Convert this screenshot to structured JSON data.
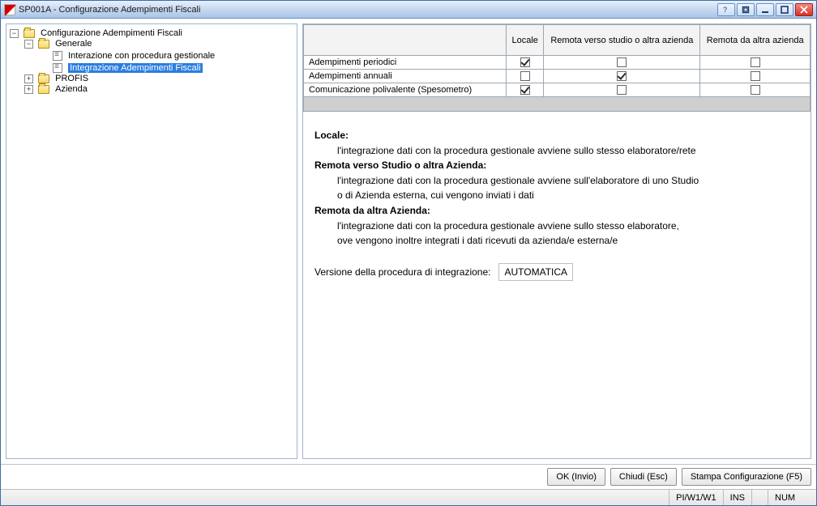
{
  "titlebar": {
    "title": "SP001A - Configurazione Adempimenti Fiscali"
  },
  "tree": {
    "root": "Configurazione Adempimenti Fiscali",
    "generale": "Generale",
    "interazione": "Interazione con procedura gestionale",
    "integrazione": "Integrazione Adempimenti Fiscali",
    "profis": "PROFIS",
    "azienda": "Azienda"
  },
  "grid": {
    "columns": [
      "Locale",
      "Remota verso studio o altra azienda",
      "Remota da altra azienda"
    ],
    "rows": [
      {
        "label": "Adempimenti periodici",
        "c0": true,
        "c1": false,
        "c2": false
      },
      {
        "label": "Adempimenti annuali",
        "c0": false,
        "c1": true,
        "c2": false
      },
      {
        "label": "Comunicazione polivalente (Spesometro)",
        "c0": true,
        "c1": false,
        "c2": false
      }
    ]
  },
  "desc": {
    "locale_label": "Locale:",
    "locale_text": "l'integrazione dati con la procedura gestionale avviene sullo stesso elaboratore/rete",
    "remota_studio_label": "Remota verso Studio o altra Azienda:",
    "remota_studio_text1": "l'integrazione dati con la procedura gestionale avviene sull'elaboratore di uno Studio",
    "remota_studio_text2": "o di Azienda esterna, cui vengono inviati i dati",
    "remota_altra_label": "Remota da altra Azienda:",
    "remota_altra_text1": "l'integrazione dati con la procedura gestionale avviene sullo stesso elaboratore,",
    "remota_altra_text2": "ove vengono inoltre integrati i dati ricevuti da azienda/e esterna/e",
    "version_label": "Versione della procedura di integrazione:",
    "version_value": "AUTOMATICA"
  },
  "buttons": {
    "ok": "OK (Invio)",
    "chiudi": "Chiudi (Esc)",
    "stampa": "Stampa Configurazione (F5)"
  },
  "status": {
    "path": "PI/W1/W1",
    "ins": "INS",
    "num": "NUM"
  }
}
